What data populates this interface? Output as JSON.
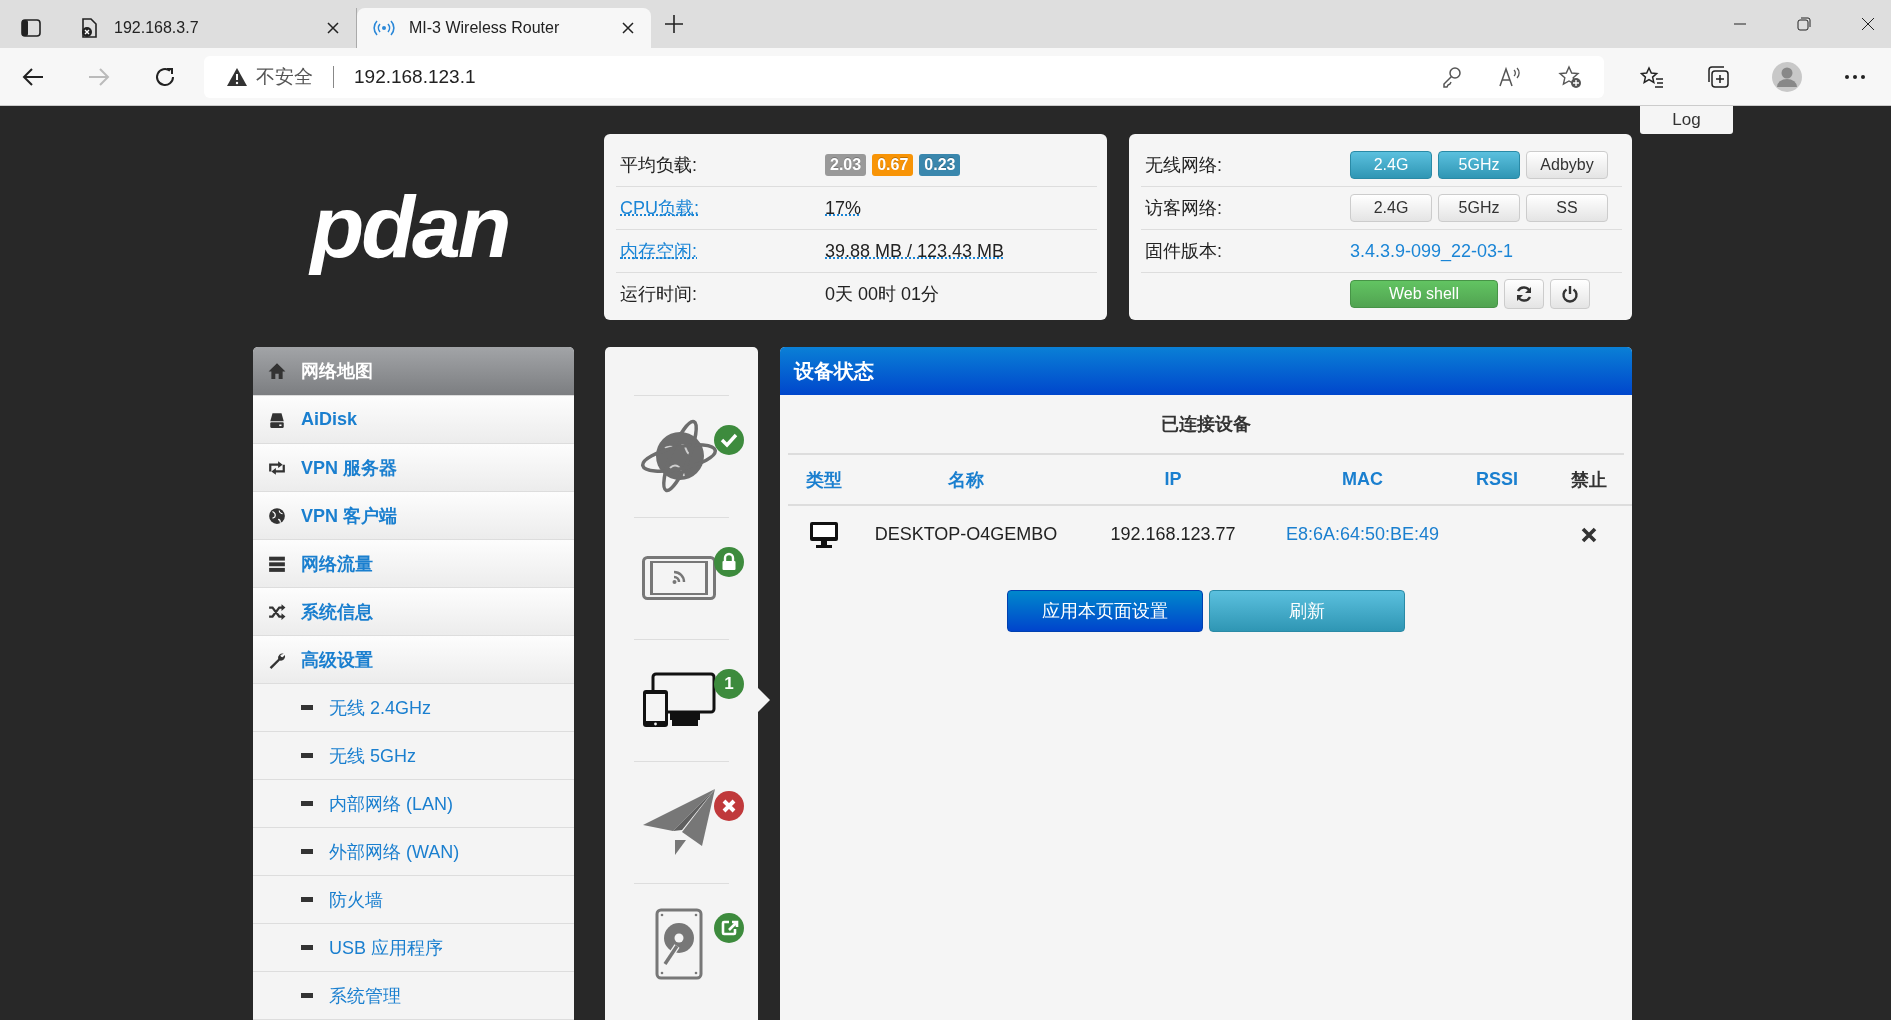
{
  "browser": {
    "tabs": [
      {
        "title": "192.168.3.7",
        "selected": false
      },
      {
        "title": "MI-3 Wireless Router",
        "selected": true
      }
    ],
    "address": {
      "security": "不安全",
      "url": "192.168.123.1"
    }
  },
  "log_button": "Log",
  "logo": "pdan",
  "system_status": [
    {
      "label": "平均负载:",
      "kind": "badges",
      "badges": [
        {
          "text": "2.03",
          "color": "#999999"
        },
        {
          "text": "0.67",
          "color": "#f89406"
        },
        {
          "text": "0.23",
          "color": "#3a87ad"
        }
      ]
    },
    {
      "label": "CPU负载:",
      "kind": "link",
      "value": "17%"
    },
    {
      "label": "内存空闲:",
      "kind": "link",
      "value": "39.88 MB / 123.43 MB"
    },
    {
      "label": "运行时间:",
      "kind": "plain",
      "value": "0天 00时 01分"
    }
  ],
  "network_status": [
    {
      "label": "无线网络:",
      "kind": "toggles",
      "buttons": [
        {
          "text": "2.4G",
          "on": true
        },
        {
          "text": "5GHz",
          "on": true
        },
        {
          "text": "Adbyby",
          "on": false
        }
      ]
    },
    {
      "label": "访客网络:",
      "kind": "toggles",
      "buttons": [
        {
          "text": "2.4G",
          "on": false
        },
        {
          "text": "5GHz",
          "on": false
        },
        {
          "text": "SS",
          "on": false
        }
      ]
    },
    {
      "label": "固件版本:",
      "kind": "link",
      "value": "3.4.3.9-099_22-03-1"
    },
    {
      "kind": "actions",
      "button": "Web shell"
    }
  ],
  "menu": [
    {
      "label": "网络地图",
      "selected": true
    },
    {
      "label": "AiDisk",
      "selected": false
    },
    {
      "label": "VPN 服务器",
      "selected": false
    },
    {
      "label": "VPN 客户端",
      "selected": false
    },
    {
      "label": "网络流量",
      "selected": false
    },
    {
      "label": "系统信息",
      "selected": false
    },
    {
      "label": "高级设置",
      "selected": false,
      "children": [
        {
          "label": "无线 2.4GHz",
          "selected": false
        },
        {
          "label": "无线 5GHz",
          "selected": false
        },
        {
          "label": "内部网络 (LAN)",
          "selected": false
        },
        {
          "label": "外部网络 (WAN)",
          "selected": false
        },
        {
          "label": "防火墙",
          "selected": false
        },
        {
          "label": "USB 应用程序",
          "selected": false
        },
        {
          "label": "系统管理",
          "selected": false
        }
      ]
    }
  ],
  "status_icons": [
    {
      "kind": "ok",
      "selected": false
    },
    {
      "kind": "locked",
      "selected": false
    },
    {
      "kind": "count",
      "count": "1",
      "selected": true
    },
    {
      "kind": "error",
      "selected": false
    },
    {
      "kind": "shared",
      "selected": false
    }
  ],
  "device_panel": {
    "title": "设备状态",
    "subtitle": "已连接设备",
    "columns": [
      {
        "label": "类型",
        "sortable": true
      },
      {
        "label": "名称",
        "sortable": true
      },
      {
        "label": "IP",
        "sortable": true
      },
      {
        "label": "MAC",
        "sortable": true
      },
      {
        "label": "RSSI",
        "sortable": true
      },
      {
        "label": "禁止",
        "sortable": false
      }
    ],
    "rows": [
      {
        "name": "DESKTOP-O4GEMBO",
        "ip": "192.168.123.77",
        "mac": "E8:6A:64:50:BE:49"
      }
    ],
    "buttons": [
      {
        "label": "应用本页面设置",
        "kind": "primary"
      },
      {
        "label": "刷新",
        "kind": "info"
      }
    ]
  }
}
